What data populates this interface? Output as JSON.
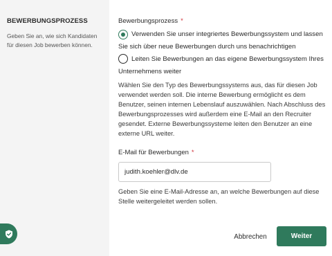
{
  "section": {
    "title": "BEWERBUNGSPROZESS",
    "description": "Geben Sie an, wie sich Kandidaten für diesen Job bewerben können."
  },
  "process": {
    "label": "Bewerbungsprozess",
    "required_mark": "*",
    "options": [
      {
        "label": "Verwenden Sie unser integriertes Bewerbungssystem und lassen Sie sich über neue Bewerbungen durch uns benachrichtigen",
        "selected": true
      },
      {
        "label": "Leiten Sie Bewerbungen an das eigene Bewerbungssystem Ihres Unternehmens weiter",
        "selected": false
      }
    ],
    "help": "Wählen Sie den Typ des Bewerbungssystems aus, das für diesen Job verwendet werden soll. Die interne Bewerbung ermöglicht es dem Benutzer, seinen internen Lebenslauf auszuwählen. Nach Abschluss des Bewerbungsprozesses wird außerdem eine E-Mail an den Recruiter gesendet. Externe Bewerbungssysteme leiten den Benutzer an eine externe URL weiter."
  },
  "email": {
    "label": "E-Mail für Bewerbungen",
    "required_mark": "*",
    "value": "judith.koehler@dlv.de",
    "help": "Geben Sie eine E-Mail-Adresse an, an welche Bewerbungen auf diese Stelle weitergeleitet werden sollen."
  },
  "actions": {
    "cancel": "Abbrechen",
    "next": "Weiter"
  },
  "colors": {
    "accent": "#2f7a5c",
    "required": "#d0343b",
    "sidebar_bg": "#f4f4f4"
  },
  "icons": {
    "floating": "shield-check-icon"
  }
}
